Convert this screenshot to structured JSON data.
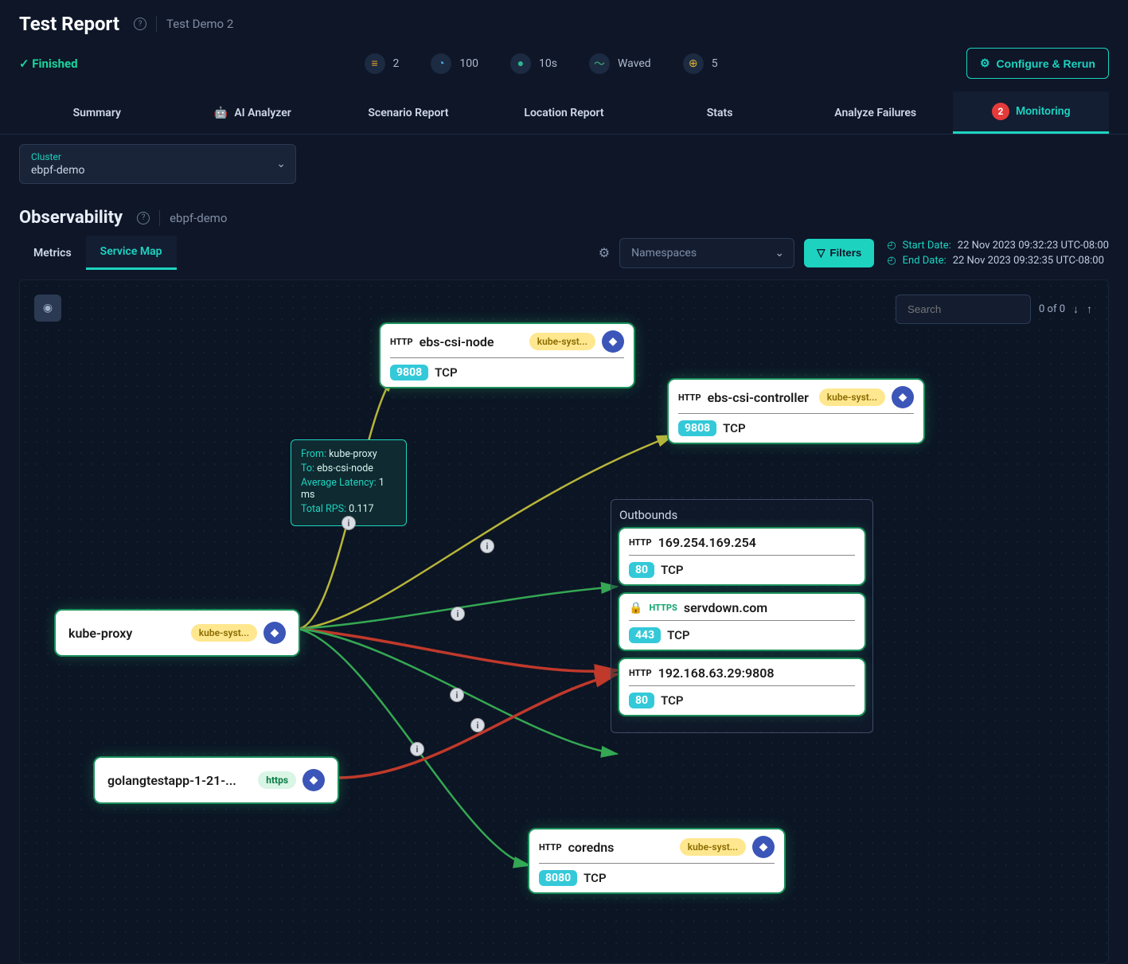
{
  "header": {
    "title": "Test Report",
    "subtitle": "Test Demo 2"
  },
  "status": {
    "label": "Finished",
    "metrics": {
      "tests": "2",
      "iterations": "100",
      "duration": "10s",
      "mode": "Waved",
      "locations": "5"
    },
    "configure_btn": "Configure & Rerun"
  },
  "tabs": {
    "summary": "Summary",
    "ai": "AI Analyzer",
    "scenario": "Scenario Report",
    "location": "Location Report",
    "stats": "Stats",
    "failures": "Analyze Failures",
    "monitoring": "Monitoring",
    "monitoring_badge": "2"
  },
  "cluster": {
    "label": "Cluster",
    "value": "ebpf-demo"
  },
  "observability": {
    "title": "Observability",
    "subtitle": "ebpf-demo",
    "subtabs": {
      "metrics": "Metrics",
      "service_map": "Service Map"
    },
    "namespaces_ph": "Namespaces",
    "filters_btn": "Filters",
    "start_label": "Start Date:",
    "end_label": "End Date:",
    "start_val": "22 Nov 2023 09:32:23 UTC-08:00",
    "end_val": "22 Nov 2023 09:32:35 UTC-08:00"
  },
  "canvas": {
    "search_ph": "Search",
    "search_count": "0 of 0",
    "outbounds_title": "Outbounds",
    "nodes": {
      "kube_proxy": {
        "title": "kube-proxy",
        "ns": "kube-syst..."
      },
      "ebs_node": {
        "title": "ebs-csi-node",
        "ns": "kube-syst...",
        "port": "9808",
        "proto": "TCP"
      },
      "ebs_ctrl": {
        "title": "ebs-csi-controller",
        "ns": "kube-syst...",
        "port": "9808",
        "proto": "TCP"
      },
      "golang": {
        "title": "golangtestapp-1-21-...",
        "tag": "https"
      },
      "coredns": {
        "title": "coredns",
        "ns": "kube-syst...",
        "port": "8080",
        "proto": "TCP"
      },
      "ip1": {
        "title": "169.254.169.254",
        "port": "80",
        "proto": "TCP"
      },
      "serv": {
        "title": "servdown.com",
        "port": "443",
        "proto": "TCP"
      },
      "ip2": {
        "title": "192.168.63.29:9808",
        "port": "80",
        "proto": "TCP"
      }
    },
    "tooltip": {
      "from_k": "From:",
      "from_v": "kube-proxy",
      "to_k": "To:",
      "to_v": "ebs-csi-node",
      "lat_k": "Average Latency:",
      "lat_v": "1 ms",
      "rps_k": "Total RPS:",
      "rps_v": "0.117"
    }
  }
}
